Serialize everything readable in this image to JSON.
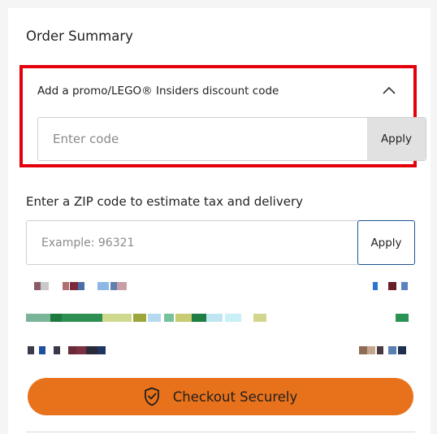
{
  "order_summary": {
    "title": "Order Summary"
  },
  "promo": {
    "label": "Add a promo/LEGO® Insiders discount code",
    "input_value": "",
    "input_placeholder": "Enter code",
    "apply_label": "Apply",
    "highlight_color": "#e3000b",
    "expanded_icon": "chevron-up-icon"
  },
  "zip": {
    "label": "Enter a ZIP code to estimate tax and delivery",
    "input_value": "",
    "input_placeholder": "Example: 96321",
    "apply_label": "Apply",
    "apply_border_color": "#1a5493"
  },
  "checkout": {
    "label": "Checkout Securely",
    "icon": "shield-check-icon",
    "color": "#e8721b"
  }
}
